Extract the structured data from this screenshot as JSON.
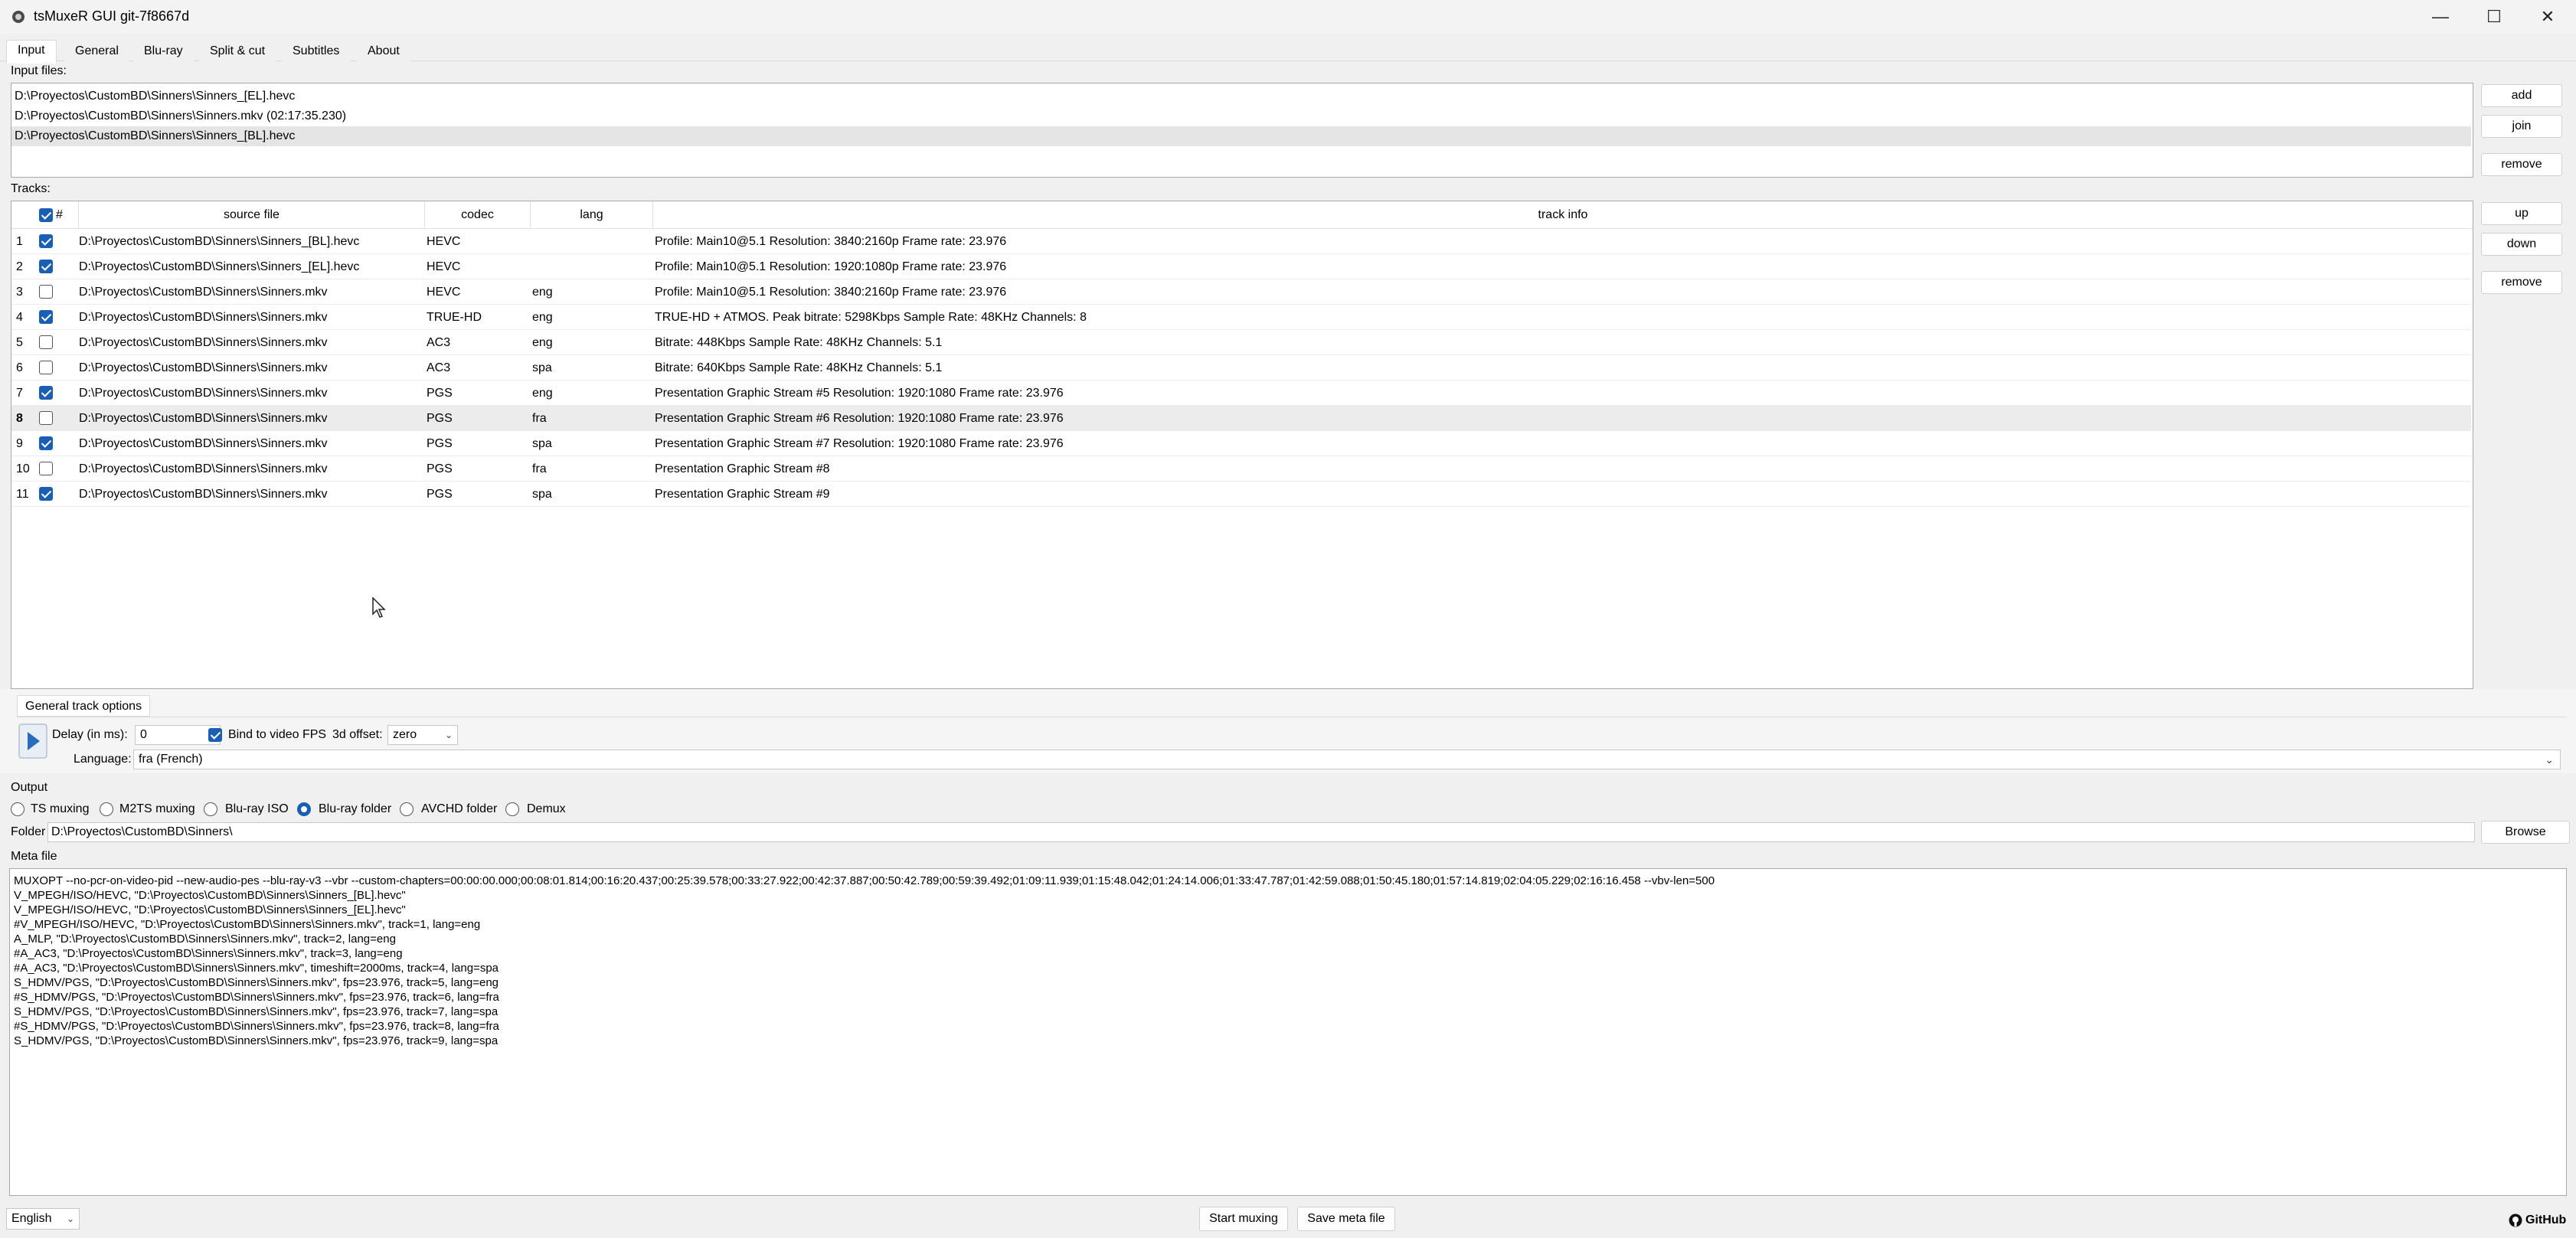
{
  "window": {
    "title": "tsMuxeR GUI git-7f8667d"
  },
  "tabs": [
    "Input",
    "General",
    "Blu-ray",
    "Split & cut",
    "Subtitles",
    "About"
  ],
  "input_files": {
    "label": "Input files:",
    "items": [
      "D:\\Proyectos\\CustomBD\\Sinners\\Sinners_[EL].hevc",
      "D:\\Proyectos\\CustomBD\\Sinners\\Sinners.mkv (02:17:35.230)",
      "D:\\Proyectos\\CustomBD\\Sinners\\Sinners_[BL].hevc"
    ],
    "buttons": {
      "add": "add",
      "join": "join",
      "remove": "remove"
    }
  },
  "tracks": {
    "label": "Tracks:",
    "columns": [
      "#",
      "source file",
      "codec",
      "lang",
      "track info"
    ],
    "rows": [
      {
        "n": "1",
        "checked": true,
        "source": "D:\\Proyectos\\CustomBD\\Sinners\\Sinners_[BL].hevc",
        "codec": "HEVC",
        "lang": "",
        "info": "Profile: Main10@5.1 Resolution: 3840:2160p  Frame rate: 23.976"
      },
      {
        "n": "2",
        "checked": true,
        "source": "D:\\Proyectos\\CustomBD\\Sinners\\Sinners_[EL].hevc",
        "codec": "HEVC",
        "lang": "",
        "info": "Profile: Main10@5.1 Resolution: 1920:1080p  Frame rate: 23.976"
      },
      {
        "n": "3",
        "checked": false,
        "source": "D:\\Proyectos\\CustomBD\\Sinners\\Sinners.mkv",
        "codec": "HEVC",
        "lang": "eng",
        "info": "Profile: Main10@5.1 Resolution: 3840:2160p  Frame rate: 23.976"
      },
      {
        "n": "4",
        "checked": true,
        "source": "D:\\Proyectos\\CustomBD\\Sinners\\Sinners.mkv",
        "codec": "TRUE-HD",
        "lang": "eng",
        "info": "TRUE-HD + ATMOS. Peak bitrate: 5298Kbps Sample Rate: 48KHz Channels: 8"
      },
      {
        "n": "5",
        "checked": false,
        "source": "D:\\Proyectos\\CustomBD\\Sinners\\Sinners.mkv",
        "codec": "AC3",
        "lang": "eng",
        "info": "Bitrate: 448Kbps Sample Rate: 48KHz Channels: 5.1"
      },
      {
        "n": "6",
        "checked": false,
        "source": "D:\\Proyectos\\CustomBD\\Sinners\\Sinners.mkv",
        "codec": "AC3",
        "lang": "spa",
        "info": "Bitrate: 640Kbps Sample Rate: 48KHz Channels: 5.1"
      },
      {
        "n": "7",
        "checked": true,
        "source": "D:\\Proyectos\\CustomBD\\Sinners\\Sinners.mkv",
        "codec": "PGS",
        "lang": "eng",
        "info": "Presentation Graphic Stream #5 Resolution: 1920:1080 Frame rate: 23.976"
      },
      {
        "n": "8",
        "checked": false,
        "source": "D:\\Proyectos\\CustomBD\\Sinners\\Sinners.mkv",
        "codec": "PGS",
        "lang": "fra",
        "info": "Presentation Graphic Stream #6 Resolution: 1920:1080 Frame rate: 23.976"
      },
      {
        "n": "9",
        "checked": true,
        "source": "D:\\Proyectos\\CustomBD\\Sinners\\Sinners.mkv",
        "codec": "PGS",
        "lang": "spa",
        "info": "Presentation Graphic Stream #7 Resolution: 1920:1080 Frame rate: 23.976"
      },
      {
        "n": "10",
        "checked": false,
        "source": "D:\\Proyectos\\CustomBD\\Sinners\\Sinners.mkv",
        "codec": "PGS",
        "lang": "fra",
        "info": "Presentation Graphic Stream #8"
      },
      {
        "n": "11",
        "checked": true,
        "source": "D:\\Proyectos\\CustomBD\\Sinners\\Sinners.mkv",
        "codec": "PGS",
        "lang": "spa",
        "info": "Presentation Graphic Stream #9"
      }
    ],
    "selected_row": "8",
    "buttons": {
      "up": "up",
      "down": "down",
      "remove": "remove"
    }
  },
  "general_track_options": {
    "title": "General track options",
    "delay_label": "Delay (in ms):",
    "delay_value": "0",
    "bind_fps_label": "Bind to video FPS",
    "bind_fps_checked": true,
    "offset_label": "3d offset:",
    "offset_value": "zero",
    "language_label": "Language:",
    "language_value": "fra (French)"
  },
  "output": {
    "label": "Output",
    "options": [
      {
        "label": "TS muxing",
        "selected": false
      },
      {
        "label": "M2TS muxing",
        "selected": false
      },
      {
        "label": "Blu-ray ISO",
        "selected": false
      },
      {
        "label": "Blu-ray folder",
        "selected": true
      },
      {
        "label": "AVCHD folder",
        "selected": false
      },
      {
        "label": "Demux",
        "selected": false
      }
    ],
    "folder_label": "Folder",
    "folder_value": "D:\\Proyectos\\CustomBD\\Sinners\\",
    "browse_label": "Browse"
  },
  "meta_file": {
    "label": "Meta file",
    "lines": [
      "MUXOPT --no-pcr-on-video-pid --new-audio-pes --blu-ray-v3 --vbr --custom-chapters=00:00:00.000;00:08:01.814;00:16:20.437;00:25:39.578;00:33:27.922;00:42:37.887;00:50:42.789;00:59:39.492;01:09:11.939;01:15:48.042;01:24:14.006;01:33:47.787;01:42:59.088;01:50:45.180;01:57:14.819;02:04:05.229;02:16:16.458 --vbv-len=500",
      "V_MPEGH/ISO/HEVC, \"D:\\Proyectos\\CustomBD\\Sinners\\Sinners_[BL].hevc\"",
      "V_MPEGH/ISO/HEVC, \"D:\\Proyectos\\CustomBD\\Sinners\\Sinners_[EL].hevc\"",
      "#V_MPEGH/ISO/HEVC, \"D:\\Proyectos\\CustomBD\\Sinners\\Sinners.mkv\", track=1, lang=eng",
      "A_MLP, \"D:\\Proyectos\\CustomBD\\Sinners\\Sinners.mkv\", track=2, lang=eng",
      "#A_AC3, \"D:\\Proyectos\\CustomBD\\Sinners\\Sinners.mkv\", track=3, lang=eng",
      "#A_AC3, \"D:\\Proyectos\\CustomBD\\Sinners\\Sinners.mkv\", timeshift=2000ms, track=4, lang=spa",
      "S_HDMV/PGS, \"D:\\Proyectos\\CustomBD\\Sinners\\Sinners.mkv\", fps=23.976, track=5, lang=eng",
      "#S_HDMV/PGS, \"D:\\Proyectos\\CustomBD\\Sinners\\Sinners.mkv\", fps=23.976, track=6, lang=fra",
      "S_HDMV/PGS, \"D:\\Proyectos\\CustomBD\\Sinners\\Sinners.mkv\", fps=23.976, track=7, lang=spa",
      "#S_HDMV/PGS, \"D:\\Proyectos\\CustomBD\\Sinners\\Sinners.mkv\", fps=23.976, track=8, lang=fra",
      "S_HDMV/PGS, \"D:\\Proyectos\\CustomBD\\Sinners\\Sinners.mkv\", fps=23.976, track=9, lang=spa"
    ]
  },
  "footer": {
    "ui_language": "English",
    "start_muxing": "Start muxing",
    "save_meta": "Save meta file",
    "github": "GitHub"
  },
  "colors": {
    "accent": "#1a5fb4",
    "selected_row": "#e5e5e5"
  }
}
